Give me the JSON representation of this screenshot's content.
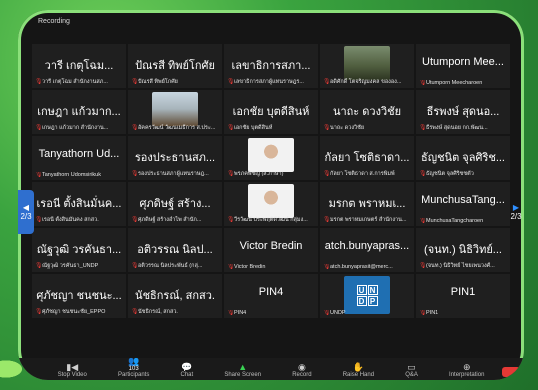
{
  "recording": "Recording",
  "page_indicator": {
    "left": "2/3",
    "right": "2/3"
  },
  "tiles": [
    {
      "name": "วารี เกตุโฉม...",
      "label": "วารี เกตุโฉม สำนักงานสภ...",
      "video": null
    },
    {
      "name": "ปัณรสี ทิพย์โกศัย",
      "label": "ปัณรสี ทิพย์โกศัย",
      "video": null
    },
    {
      "name": "เลขาธิการสภา...",
      "label": "เลขาธิการสภาผู้แทนราษฎร...",
      "video": null
    },
    {
      "name": "",
      "label": "อดิศักดิ์ โตจริญมงคล ขององ...",
      "video": "person"
    },
    {
      "name": "Utumporn Mee...",
      "label": "Utumporn Meecharoen",
      "video": null
    },
    {
      "name": "เกษฎา แก้วมาก...",
      "label": "เกษฎา แก้วมาก สำนักงาน...",
      "video": null
    },
    {
      "name": "",
      "label": "อัคครวัฒน์ วัฒนเมธีการ ส.ประ...",
      "video": "outdoor"
    },
    {
      "name": "เอกชัย บุตดีสินห์",
      "label": "เอกชัย บุตดีสินห์",
      "video": null
    },
    {
      "name": "นาถะ ดวงวิชัย",
      "label": "นาถะ ดวงวิชัย",
      "video": null
    },
    {
      "name": "ธีรพงษ์ สุดนอ...",
      "label": "ธีรพงษ์ สุดนอย กก.พัฒน...",
      "video": null
    },
    {
      "name": "Tanyathorn Ud...",
      "label": "Tanyathorn Udomsirikuk",
      "video": null
    },
    {
      "name": "รองประธานสภ...",
      "label": "รองประธานสภาผู้แทนราษฎ...",
      "video": null
    },
    {
      "name": "",
      "label": "พรภคพิชญ์ (ส.ภาษา)",
      "video": "face"
    },
    {
      "name": "กัลยา โซติธาดา...",
      "label": "กัลยา โซติธาดา ส.การพิมพ์",
      "video": null
    },
    {
      "name": "ธัญชนิต จุลศิริช...",
      "label": "ธัญชนิต จุลศิริชชตั๋ว",
      "video": null
    },
    {
      "name": "เรอนี ตั้งสินมั่นค...",
      "label": "เรอนี ตั้งสินมั่นคง สกสว.",
      "video": null
    },
    {
      "name": "ศุภดิษฐ์ สร้าง...",
      "label": "ศุภดิษฐ์ สร้างอำไพ สำนัก...",
      "video": null
    },
    {
      "name": "",
      "label": "วีรวัฒน์ ประพฤติดีวัฒน์ กลุ่มง...",
      "video": "face2"
    },
    {
      "name": "มรกต พราหมเ...",
      "label": "มรกต พราหมเกษตร์ สำนักงาน...",
      "video": null
    },
    {
      "name": "MunchusaTang...",
      "label": "MunchusaTangcharoen",
      "video": null
    },
    {
      "name": "ณัฐวุฒิ วรคันธา...",
      "label": "ณัฐวุฒิ วรคันธา_UNDP",
      "video": null
    },
    {
      "name": "อติวรรณ นิลป...",
      "label": "อติวรรณ นิลประพันธ์ (กลุ่...",
      "video": null
    },
    {
      "name": "Victor Bredin",
      "label": "Victor Bredin",
      "video": null
    },
    {
      "name": "atch.bunyapras...",
      "label": "atch.bunyaprasit@merc...",
      "video": null
    },
    {
      "name": "(จนท.) นิธิวิทย์...",
      "label": "(จนท.) นิธิวิทย์ ไชยเพนวงศ์...",
      "video": null
    },
    {
      "name": "ศุภัชญา ชนชนะ...",
      "label": "ศุภัชญา ชนชนะชัย_EPPO",
      "video": null
    },
    {
      "name": "นัชธิกรณ์, สกสว.",
      "label": "นัชธิกรณ์, สกสว.",
      "video": null
    },
    {
      "name": "PIN4",
      "label": "PIN4",
      "video": null
    },
    {
      "name": "",
      "label": "UNDP",
      "video": "undp"
    },
    {
      "name": "PIN1",
      "label": "PIN1",
      "video": null
    }
  ],
  "undp_logo": [
    "U",
    "N",
    "D",
    "P"
  ],
  "toolbar": [
    {
      "label": "Stop Video",
      "icon": "video-icon"
    },
    {
      "label": "Participants",
      "icon": "participants-icon",
      "badge": "103"
    },
    {
      "label": "Chat",
      "icon": "chat-icon"
    },
    {
      "label": "Share Screen",
      "icon": "share-screen-icon"
    },
    {
      "label": "Record",
      "icon": "record-icon"
    },
    {
      "label": "Raise Hand",
      "icon": "raise-hand-icon"
    },
    {
      "label": "Q&A",
      "icon": "qa-icon"
    },
    {
      "label": "Interpretation",
      "icon": "interpretation-icon"
    }
  ]
}
